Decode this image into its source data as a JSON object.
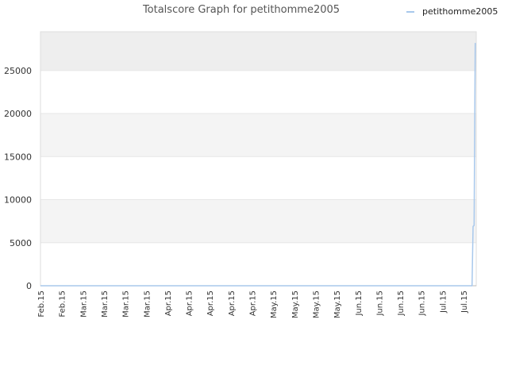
{
  "chart_data": {
    "type": "line",
    "title": "Totalscore Graph for petithomme2005",
    "xlabel": "",
    "ylabel": "",
    "ylim": [
      0,
      29500
    ],
    "yticks": [
      0,
      5000,
      10000,
      15000,
      20000,
      25000
    ],
    "xtick_labels": [
      "Feb.15",
      "Feb.15",
      "Mar.15",
      "Mar.15",
      "Mar.15",
      "Mar.15",
      "Apr.15",
      "Apr.15",
      "Apr.15",
      "Apr.15",
      "Apr.15",
      "May.15",
      "May.15",
      "May.15",
      "May.15",
      "Jun.15",
      "Jun.15",
      "Jun.15",
      "Jun.15",
      "Jul.15",
      "Jul.15"
    ],
    "grid": true,
    "legend": {
      "position": "top-right"
    },
    "series": [
      {
        "name": "petithomme2005",
        "color": "#a8c8ec",
        "x": [
          0,
          0.5,
          1,
          2,
          3,
          4,
          5,
          6,
          7,
          8,
          9,
          10,
          11,
          12,
          13,
          14,
          15,
          16,
          17,
          18,
          19,
          20,
          20.4,
          20.45,
          20.5,
          20.55
        ],
        "y": [
          0,
          0,
          0,
          0,
          0,
          0,
          0,
          0,
          0,
          0,
          0,
          0,
          0,
          0,
          0,
          0,
          0,
          0,
          0,
          0,
          0,
          0,
          0,
          6900,
          7000,
          28200
        ]
      }
    ]
  }
}
